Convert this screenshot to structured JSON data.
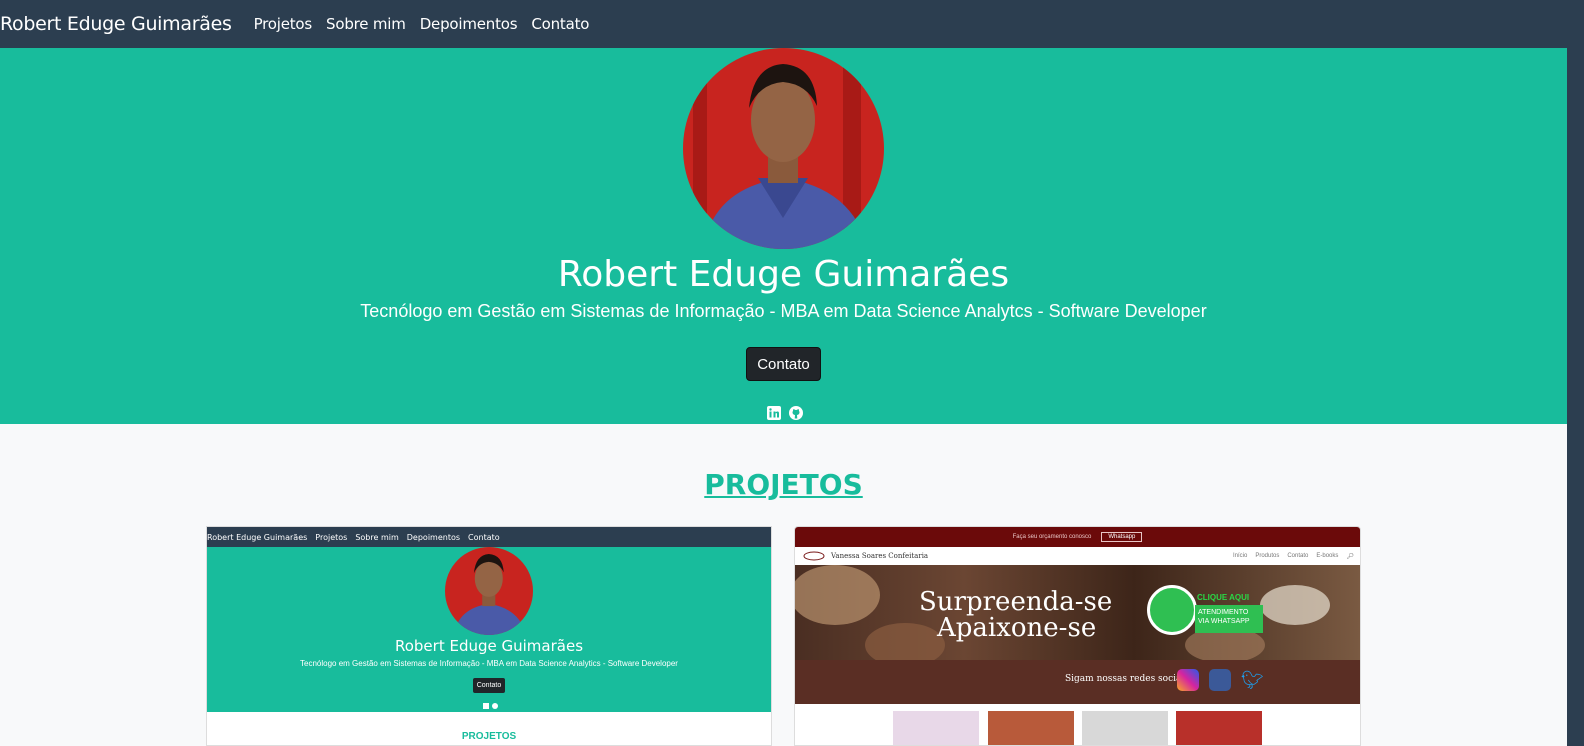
{
  "navbar": {
    "brand": "Robert Eduge Guimarães",
    "links": [
      "Projetos",
      "Sobre mim",
      "Depoimentos",
      "Contato"
    ]
  },
  "hero": {
    "name": "Robert Eduge Guimarães",
    "subtitle": "Tecnólogo em Gestão em Sistemas de Informação - MBA em Data Science Analytcs - Software Developer",
    "button": "Contato",
    "social_icons": [
      "linkedin-icon",
      "github-icon"
    ]
  },
  "projects": {
    "title": "PROJETOS",
    "cards": [
      {
        "nav_brand": "Robert Eduge Guimarães",
        "nav_links": [
          "Projetos",
          "Sobre mim",
          "Depoimentos",
          "Contato"
        ],
        "name": "Robert Eduge Guimarães",
        "subtitle": "Tecnólogo em Gestão em Sistemas de Informação - MBA em Data Science Analytics - Software Developer",
        "button": "Contato",
        "section": "PROJETOS"
      },
      {
        "topbar": "Faça seu orçamento conosco",
        "topbar_button": "Whatsapp",
        "brand": "Vanessa Soares Confeitaria",
        "nav_links": [
          "Início",
          "Produtos",
          "Contato",
          "E-books"
        ],
        "banner_line1": "Surpreenda-se",
        "banner_line2": "Apaixone-se",
        "wa_label": "CLIQUE AQUI",
        "wa_box": "ATENDIMENTO VIA WHATSAPP",
        "social_label": "Sigam nossas redes sociais"
      }
    ]
  },
  "colors": {
    "navbar": "#2c3e50",
    "hero": "#18bc9c",
    "button": "#212529"
  }
}
